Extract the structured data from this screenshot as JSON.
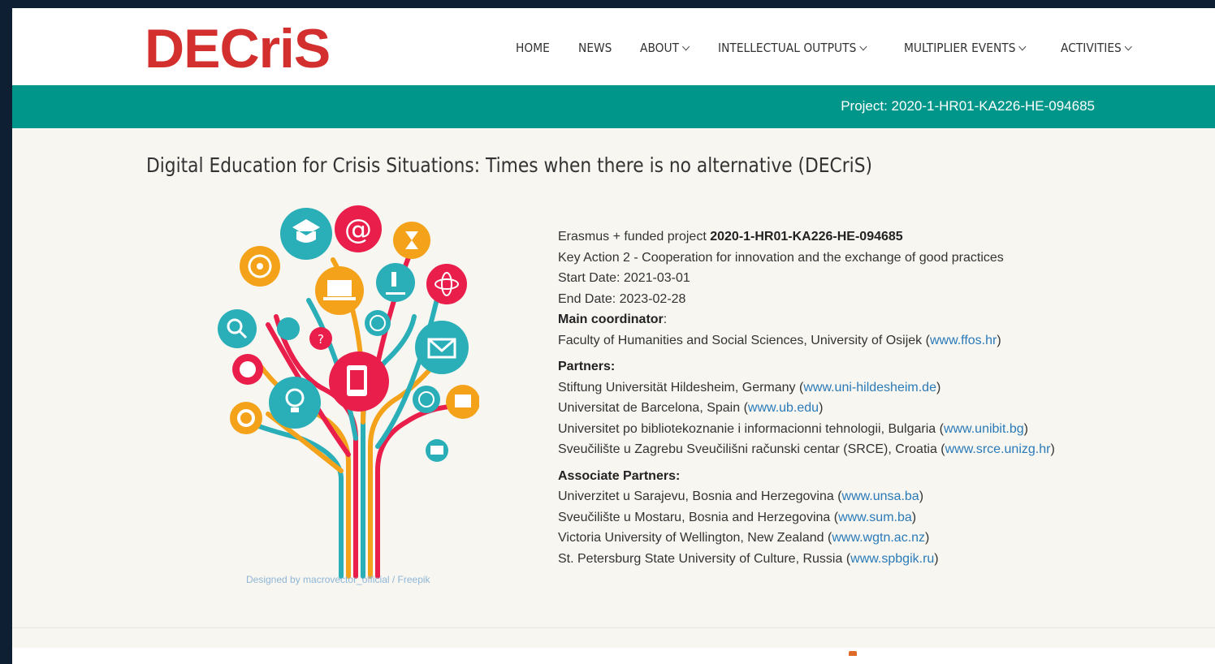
{
  "logo": {
    "part1": "DEC",
    "part2": "riS"
  },
  "nav": [
    {
      "label": "HOME",
      "dropdown": false
    },
    {
      "label": "NEWS",
      "dropdown": false
    },
    {
      "label": "ABOUT",
      "dropdown": true
    },
    {
      "label": "INTELLECTUAL OUTPUTS",
      "dropdown": true
    },
    {
      "label": "MULTIPLIER EVENTS",
      "dropdown": true
    },
    {
      "label": "ACTIVITIES",
      "dropdown": true
    }
  ],
  "band": {
    "project": "Project: 2020-1-HR01-KA226-HE-094685"
  },
  "title": "Digital Education for Crisis Situations: Times when there is no alternative (DECriS)",
  "credit": "Designed by macrovector_official / Freepik",
  "info": {
    "erasmus_prefix": "Erasmus +  funded project  ",
    "project_code": "2020-1-HR01-KA226-HE-094685",
    "key_action": "Key Action 2 - Cooperation for innovation and the exchange of good practices",
    "start_date": "Start Date: 2021-03-01",
    "end_date": "End Date: 2023-02-28",
    "coordinator_heading": "Main coordinator",
    "coordinator_colon": ":",
    "coordinator_name": "Faculty of Humanities and Social Sciences, University of Osijek (",
    "coordinator_link": "www.ffos.hr",
    "close_paren": ")"
  },
  "partners": {
    "heading": "Partners:",
    "items": [
      {
        "name": "Stiftung Universität Hildesheim, Germany (",
        "link": "www.uni-hildesheim.de"
      },
      {
        "name": "Universitat de Barcelona, Spain (",
        "link": "www.ub.edu"
      },
      {
        "name": "Universitet po bibliotekoznanie i informacionni tehnologii, Bulgaria (",
        "link": "www.unibit.bg"
      },
      {
        "name": "Sveučilište u Zagrebu Sveučilišni računski centar (SRCE), Croatia (",
        "link": "www.srce.unizg.hr"
      }
    ]
  },
  "associates": {
    "heading": "Associate Partners:",
    "items": [
      {
        "name": "Univerzitet u Sarajevu, Bosnia and Herzegovina (",
        "link": "www.unsa.ba"
      },
      {
        "name": "Sveučilište u Mostaru, Bosnia and Herzegovina (",
        "link": "www.sum.ba"
      },
      {
        "name": "Victoria University of Wellington, New Zealand (",
        "link": "www.wgtn.ac.nz"
      },
      {
        "name": "St. Petersburg State University of Culture, Russia (",
        "link": "www.spbgik.ru"
      }
    ]
  },
  "colors": {
    "accent": "#00968a",
    "logo": "#d32f2f",
    "link": "#2a7ab8"
  },
  "icons": [
    "graduation-icon",
    "email-at-icon",
    "hourglass-icon",
    "target-icon",
    "laptop-icon",
    "microscope-icon",
    "atom-icon",
    "search-icon",
    "dna-icon",
    "question-icon",
    "globe-icon",
    "envelope-icon",
    "world-icon",
    "tablet-icon",
    "mouse-icon",
    "gear-icon",
    "idea-icon",
    "clock-icon",
    "building-icon",
    "mail-icon"
  ]
}
